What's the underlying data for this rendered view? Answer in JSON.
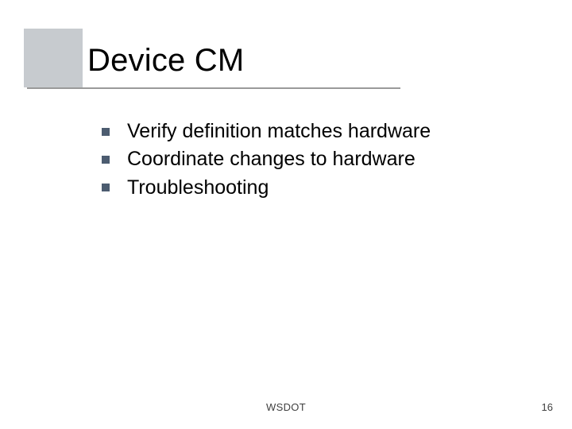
{
  "slide": {
    "title": "Device CM",
    "bullets": [
      "Verify definition matches hardware",
      "Coordinate changes to hardware",
      "Troubleshooting"
    ],
    "footer": {
      "center": "WSDOT",
      "page_number": "16"
    }
  }
}
